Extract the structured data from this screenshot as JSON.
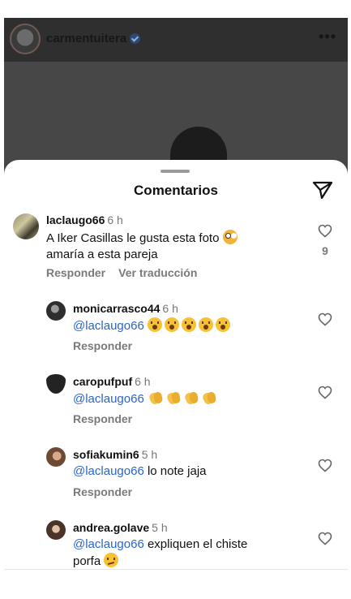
{
  "post": {
    "username": "carmentuitera",
    "more_label": "•••"
  },
  "sheet": {
    "title": "Comentarios"
  },
  "comments": [
    {
      "user": "laclaugo66",
      "time": "6 h",
      "text_1": "A Iker Casillas le gusta esta foto",
      "text_2": "amaría a esta pareja",
      "reply_label": "Responder",
      "translate_label": "Ver traducción",
      "likes": "9"
    },
    {
      "user": "monicarrasco44",
      "time": "6 h",
      "mention": "@laclaugo66",
      "reply_label": "Responder"
    },
    {
      "user": "caropufpuf",
      "time": "6 h",
      "mention": "@laclaugo66",
      "reply_label": "Responder"
    },
    {
      "user": "sofiakumin6",
      "time": "5 h",
      "mention": "@laclaugo66",
      "text": "lo note jaja",
      "reply_label": "Responder"
    },
    {
      "user": "andrea.golave",
      "time": "5 h",
      "mention": "@laclaugo66",
      "text_1": "expliquen el chiste",
      "text_2": "porfa"
    }
  ],
  "icons": {
    "send": "paper-plane-icon",
    "heart": "heart-outline-icon",
    "verified": "verified-badge-icon",
    "more": "more-dots-icon"
  },
  "colors": {
    "mention": "#2b64c8",
    "secondary_text": "#777777"
  }
}
